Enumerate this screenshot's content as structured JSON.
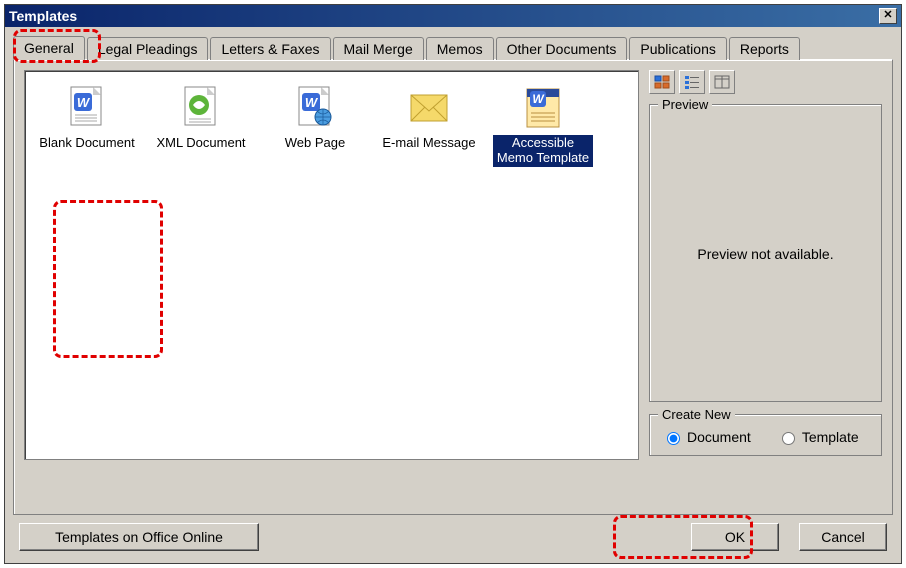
{
  "window": {
    "title": "Templates"
  },
  "tabs": [
    {
      "label": "General",
      "active": true
    },
    {
      "label": "Legal Pleadings",
      "active": false
    },
    {
      "label": "Letters & Faxes",
      "active": false
    },
    {
      "label": "Mail Merge",
      "active": false
    },
    {
      "label": "Memos",
      "active": false
    },
    {
      "label": "Other Documents",
      "active": false
    },
    {
      "label": "Publications",
      "active": false
    },
    {
      "label": "Reports",
      "active": false
    }
  ],
  "templates": [
    {
      "label": "Blank Document",
      "icon": "word-doc",
      "selected": false
    },
    {
      "label": "XML Document",
      "icon": "xml-doc",
      "selected": false
    },
    {
      "label": "Web Page",
      "icon": "web-page",
      "selected": false
    },
    {
      "label": "E-mail Message",
      "icon": "email",
      "selected": false
    },
    {
      "label": "Accessible Memo Template",
      "icon": "word-template",
      "selected": true
    }
  ],
  "preview": {
    "group_label": "Preview",
    "message": "Preview not available."
  },
  "create_new": {
    "group_label": "Create New",
    "options": [
      {
        "label": "Document",
        "checked": true
      },
      {
        "label": "Template",
        "checked": false
      }
    ]
  },
  "buttons": {
    "office_online": "Templates on Office Online",
    "ok": "OK",
    "cancel": "Cancel"
  }
}
